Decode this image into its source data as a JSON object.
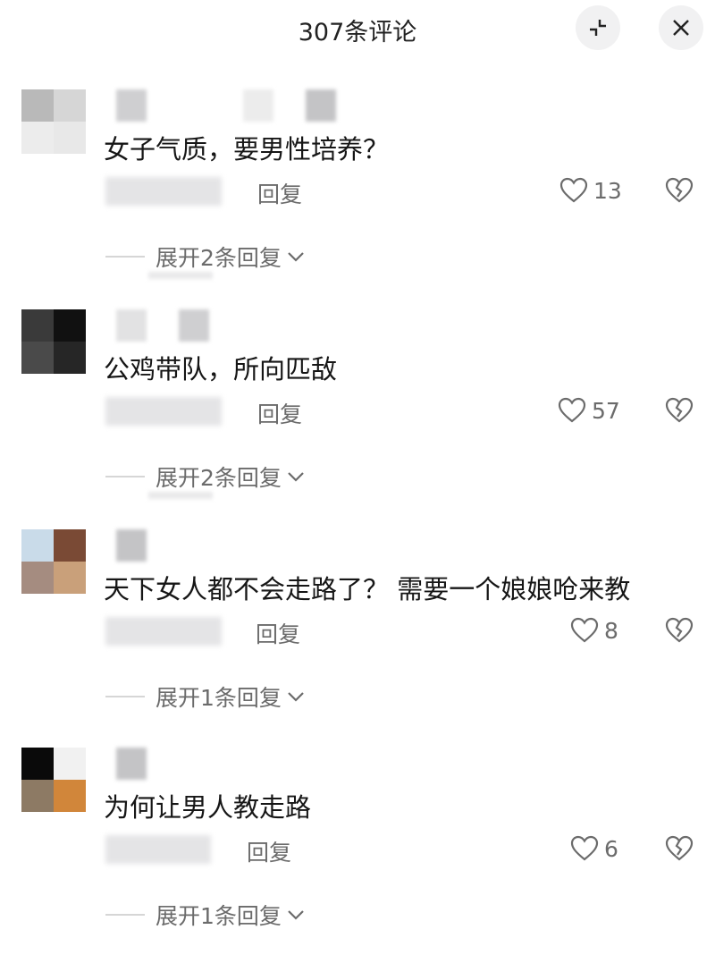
{
  "header": {
    "title": "307条评论",
    "collapse_icon": "collapse-icon",
    "close_icon": "close-icon"
  },
  "comments": [
    {
      "avatar_colors": [
        "#b9b9b9",
        "#d6d6d6",
        "#ececec",
        "#e8e8e8"
      ],
      "text": "女子气质，要男性培养？",
      "reply_label": "回复",
      "likes": "13",
      "expand_label": "展开2条回复"
    },
    {
      "avatar_colors": [
        "#3a3a3a",
        "#111111",
        "#4a4a4a",
        "#262626"
      ],
      "text": "公鸡带队，所向匹敌",
      "reply_label": "回复",
      "likes": "57",
      "expand_label": "展开2条回复"
    },
    {
      "avatar_colors": [
        "#c9dbe9",
        "#7a4a35",
        "#a58c80",
        "#c9a07a"
      ],
      "text": "天下女人都不会走路了？ 需要一个娘娘呛来教",
      "reply_label": "回复",
      "likes": "8",
      "expand_label": "展开1条回复"
    },
    {
      "avatar_colors": [
        "#0a0a0a",
        "#f1f1f1",
        "#8d7a64",
        "#d1863a"
      ],
      "text": "为何让男人教走路",
      "reply_label": "回复",
      "likes": "6",
      "expand_label": "展开1条回复"
    }
  ],
  "colors": {
    "text": "#161616",
    "muted": "#6b6b6b",
    "button_bg": "#f1f1f2"
  }
}
